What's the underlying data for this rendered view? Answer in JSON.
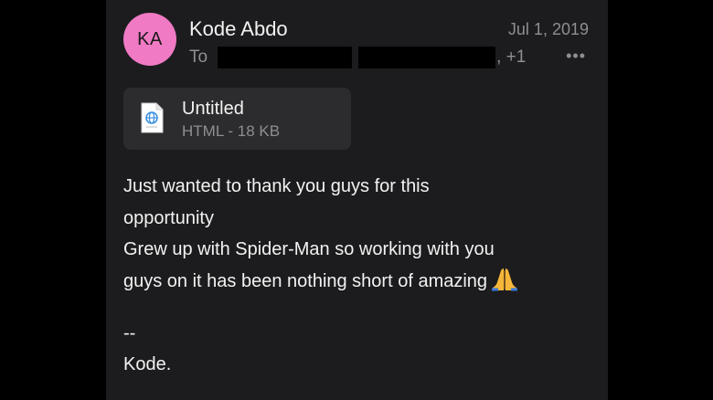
{
  "colors": {
    "avatar": "#f07ac4",
    "background": "#1c1c1e",
    "attachment_bg": "#2c2c2e",
    "primary_text": "#f2f2f2",
    "secondary_text": "#8e8e93"
  },
  "email": {
    "avatar_initials": "KA",
    "sender_name": "Kode Abdo",
    "date": "Jul 1, 2019",
    "to_label": "To",
    "recipients_extra": ", +1",
    "more_icon": "•••",
    "attachment": {
      "icon": "html-file-icon",
      "name": "Untitled",
      "meta": "HTML - 18 KB"
    },
    "body": {
      "line1": "Just wanted to thank you guys for this",
      "line2": "opportunity",
      "line3": "Grew up with Spider-Man so working with you",
      "line4": "guys on it has been nothing short of amazing",
      "emoji": "folded-hands-emoji"
    },
    "signature": {
      "separator": "--",
      "name": "Kode."
    }
  }
}
